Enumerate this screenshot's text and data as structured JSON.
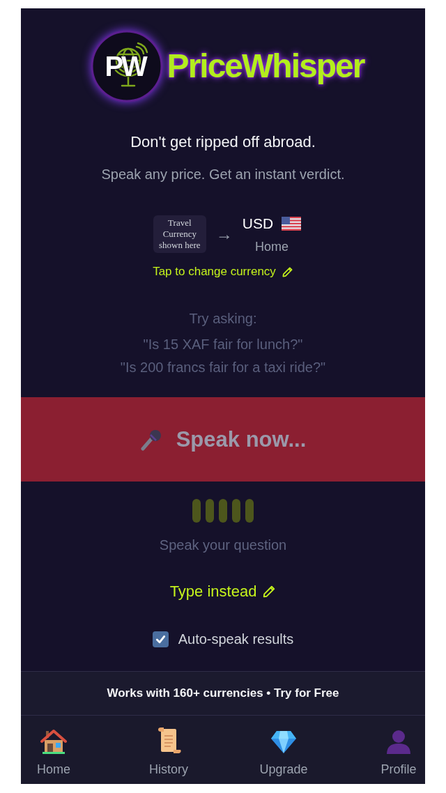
{
  "logo": {
    "initials": "PW",
    "name": "PriceWhisper"
  },
  "tagline": "Don't get ripped off abroad.",
  "subtitle": "Speak any price. Get an instant verdict.",
  "currency": {
    "travel_placeholder": "Travel Currency shown here",
    "arrow": "→",
    "home_code": "USD",
    "home_label": "Home",
    "change_link": "Tap to change currency"
  },
  "examples": {
    "heading": "Try asking:",
    "items": [
      "\"Is 15 XAF fair for lunch?\"",
      "\"Is 200 francs fair for a taxi ride?\""
    ]
  },
  "speak_button": {
    "label": "Speak now..."
  },
  "voice_prompt": "Speak your question",
  "type_link": "Type instead",
  "auto_speak": {
    "label": "Auto-speak results",
    "checked": true
  },
  "promo_banner": "Works with 160+ currencies • Try for Free",
  "nav": [
    {
      "label": "Home",
      "kind": "home"
    },
    {
      "label": "History",
      "kind": "history"
    },
    {
      "label": "Upgrade",
      "kind": "upgrade"
    },
    {
      "label": "Profile",
      "kind": "profile"
    }
  ]
}
